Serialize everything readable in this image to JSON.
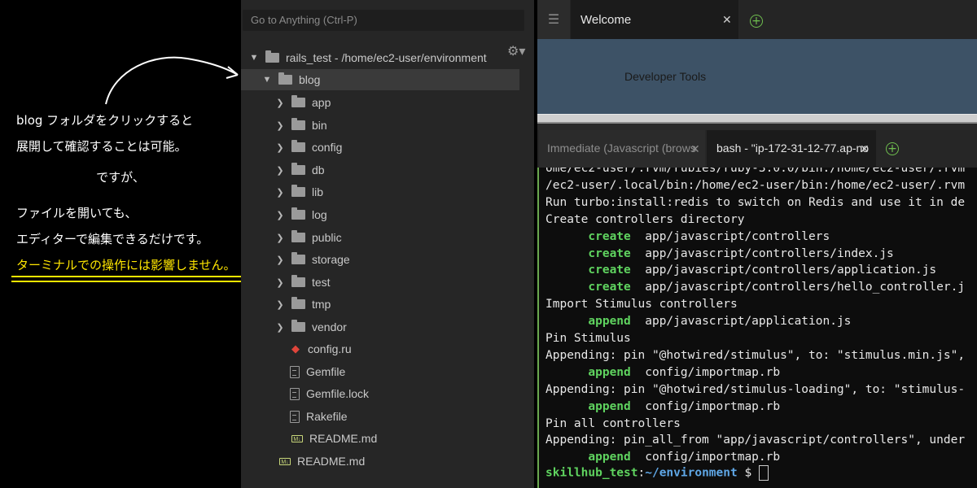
{
  "annotation": {
    "lines": [
      "blog フォルダをクリックすると",
      "展開して確認することは可能。",
      "ですが、",
      "ファイルを開いても、",
      "エディターで編集できるだけです。",
      "ターミナルでの操作には影響しません。"
    ],
    "colors": {
      "text": "#ffffff",
      "highlight": "#ffe600"
    }
  },
  "tree": {
    "search_placeholder": "Go to Anything (Ctrl-P)",
    "settings_icon": "gear-icon",
    "root": {
      "name": "rails_test",
      "path": " - /home/ec2-user/environment"
    },
    "items": [
      {
        "label": "blog",
        "kind": "folder",
        "expanded": true,
        "selected": true
      },
      {
        "label": "app",
        "kind": "folder"
      },
      {
        "label": "bin",
        "kind": "folder"
      },
      {
        "label": "config",
        "kind": "folder"
      },
      {
        "label": "db",
        "kind": "folder"
      },
      {
        "label": "lib",
        "kind": "folder"
      },
      {
        "label": "log",
        "kind": "folder"
      },
      {
        "label": "public",
        "kind": "folder"
      },
      {
        "label": "storage",
        "kind": "folder"
      },
      {
        "label": "test",
        "kind": "folder"
      },
      {
        "label": "tmp",
        "kind": "folder"
      },
      {
        "label": "vendor",
        "kind": "folder"
      },
      {
        "label": "config.ru",
        "kind": "ruby"
      },
      {
        "label": "Gemfile",
        "kind": "file"
      },
      {
        "label": "Gemfile.lock",
        "kind": "file"
      },
      {
        "label": "Rakefile",
        "kind": "file"
      },
      {
        "label": "README.md",
        "kind": "markdown"
      },
      {
        "label": "README.md",
        "kind": "markdown"
      }
    ]
  },
  "editor": {
    "top_tab": "Welcome",
    "welcome_text": "Developer Tools",
    "bottom_tabs": [
      "Immediate (Javascript (brows",
      "bash - \"ip-172-31-12-77.ap-no"
    ],
    "colors": {
      "welcome_bg": "#3d5266",
      "accent_green": "#6fbf4f"
    }
  },
  "terminal": {
    "lines": [
      {
        "text": "ome/ec2-user/.rvm/rubies/ruby-3.0.0/bin:/home/ec2-user/.rvm"
      },
      {
        "text": "/ec2-user/.local/bin:/home/ec2-user/bin:/home/ec2-user/.rvm"
      },
      {
        "text": "Run turbo:install:redis to switch on Redis and use it in de"
      },
      {
        "text": "Create controllers directory"
      },
      {
        "kw": "create",
        "text": "  app/javascript/controllers"
      },
      {
        "kw": "create",
        "text": "  app/javascript/controllers/index.js"
      },
      {
        "kw": "create",
        "text": "  app/javascript/controllers/application.js"
      },
      {
        "kw": "create",
        "text": "  app/javascript/controllers/hello_controller.j"
      },
      {
        "text": "Import Stimulus controllers"
      },
      {
        "kw": "append",
        "text": "  app/javascript/application.js"
      },
      {
        "text": "Pin Stimulus"
      },
      {
        "text": "Appending: pin \"@hotwired/stimulus\", to: \"stimulus.min.js\","
      },
      {
        "kw": "append",
        "text": "  config/importmap.rb"
      },
      {
        "text": "Appending: pin \"@hotwired/stimulus-loading\", to: \"stimulus-"
      },
      {
        "kw": "append",
        "text": "  config/importmap.rb"
      },
      {
        "text": "Pin all controllers"
      },
      {
        "text": "Appending: pin_all_from \"app/javascript/controllers\", under"
      },
      {
        "kw": "append",
        "text": "  config/importmap.rb"
      }
    ],
    "prompt_user": "skillhub_test",
    "prompt_sep": ":",
    "prompt_path": "~/environment",
    "prompt_symbol": " $ "
  }
}
